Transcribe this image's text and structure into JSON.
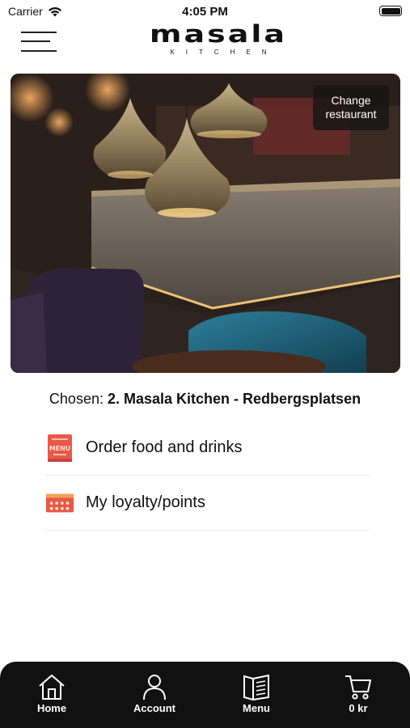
{
  "status_bar": {
    "carrier": "Carrier",
    "time": "4:05 PM",
    "icons": [
      "wifi-icon",
      "battery-icon"
    ]
  },
  "header": {
    "logo_main": "masala",
    "logo_sub": "KITCHEN",
    "menu_icon": "hamburger-icon"
  },
  "hero": {
    "change_button": "Change restaurant"
  },
  "chosen": {
    "prefix": "Chosen:",
    "restaurant": "2. Masala Kitchen - Redbergsplatsen"
  },
  "menu": {
    "items": [
      {
        "label": "Order food and drinks",
        "icon": "menu-book-icon"
      },
      {
        "label": "My loyalty/points",
        "icon": "loyalty-card-icon"
      }
    ]
  },
  "bottom_nav": {
    "items": [
      {
        "label": "Home",
        "icon": "home-icon"
      },
      {
        "label": "Account",
        "icon": "account-icon"
      },
      {
        "label": "Menu",
        "icon": "menu-icon"
      },
      {
        "label": "0 kr",
        "icon": "cart-icon"
      }
    ]
  },
  "colors": {
    "nav_background": "#111111",
    "menu_icon_red": "#e8584a",
    "accent_orange": "#f4a259"
  }
}
